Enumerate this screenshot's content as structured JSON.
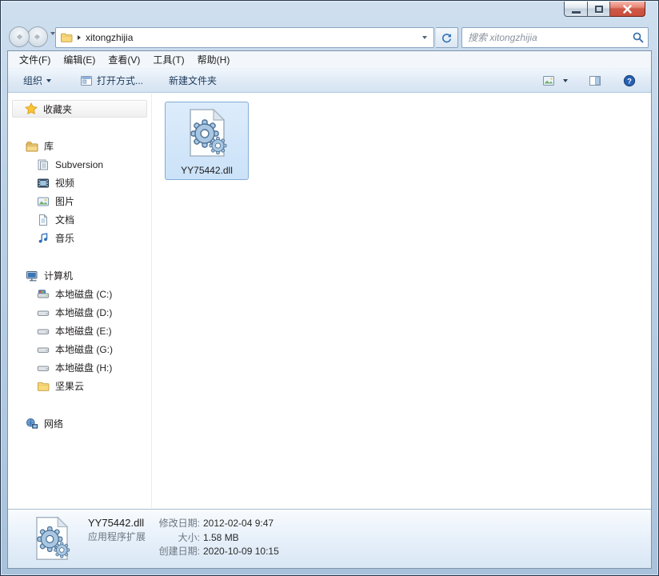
{
  "address_bar": {
    "path": "xitongzhijia"
  },
  "search": {
    "placeholder": "搜索 xitongzhijia"
  },
  "menu": {
    "items": [
      "文件(F)",
      "编辑(E)",
      "查看(V)",
      "工具(T)",
      "帮助(H)"
    ]
  },
  "toolbar": {
    "organize": "组织",
    "open_with": "打开方式...",
    "new_folder": "新建文件夹"
  },
  "sidebar": {
    "groups": [
      {
        "name": "favorites",
        "icon": "star",
        "label": "收藏夹",
        "band": true,
        "items": []
      },
      {
        "name": "libraries",
        "icon": "libraries",
        "label": "库",
        "items": [
          {
            "icon": "library",
            "label": "Subversion"
          },
          {
            "icon": "videos",
            "label": "视频"
          },
          {
            "icon": "pictures",
            "label": "图片"
          },
          {
            "icon": "documents",
            "label": "文档"
          },
          {
            "icon": "music",
            "label": "音乐"
          }
        ]
      },
      {
        "name": "computer",
        "icon": "computer",
        "label": "计算机",
        "items": [
          {
            "icon": "drive-system",
            "label": "本地磁盘 (C:)"
          },
          {
            "icon": "drive",
            "label": "本地磁盘 (D:)"
          },
          {
            "icon": "drive",
            "label": "本地磁盘 (E:)"
          },
          {
            "icon": "drive",
            "label": "本地磁盘 (G:)"
          },
          {
            "icon": "drive",
            "label": "本地磁盘 (H:)"
          },
          {
            "icon": "folder",
            "label": "坚果云"
          }
        ]
      },
      {
        "name": "network",
        "icon": "network",
        "label": "网络",
        "items": []
      }
    ]
  },
  "files": [
    {
      "icon": "dll",
      "name": "YY75442.dll",
      "selected": true
    }
  ],
  "details": {
    "name": "YY75442.dll",
    "type": "应用程序扩展",
    "rows": [
      {
        "label": "修改日期:",
        "value": "2012-02-04 9:47"
      },
      {
        "label": "大小:",
        "value": "1.58 MB"
      },
      {
        "label": "创建日期:",
        "value": "2020-10-09 10:15"
      }
    ]
  },
  "colors": {
    "accent_selection": "#84acdd",
    "toolbar_text": "#1e3a5a",
    "close_button": "#cf5846"
  }
}
